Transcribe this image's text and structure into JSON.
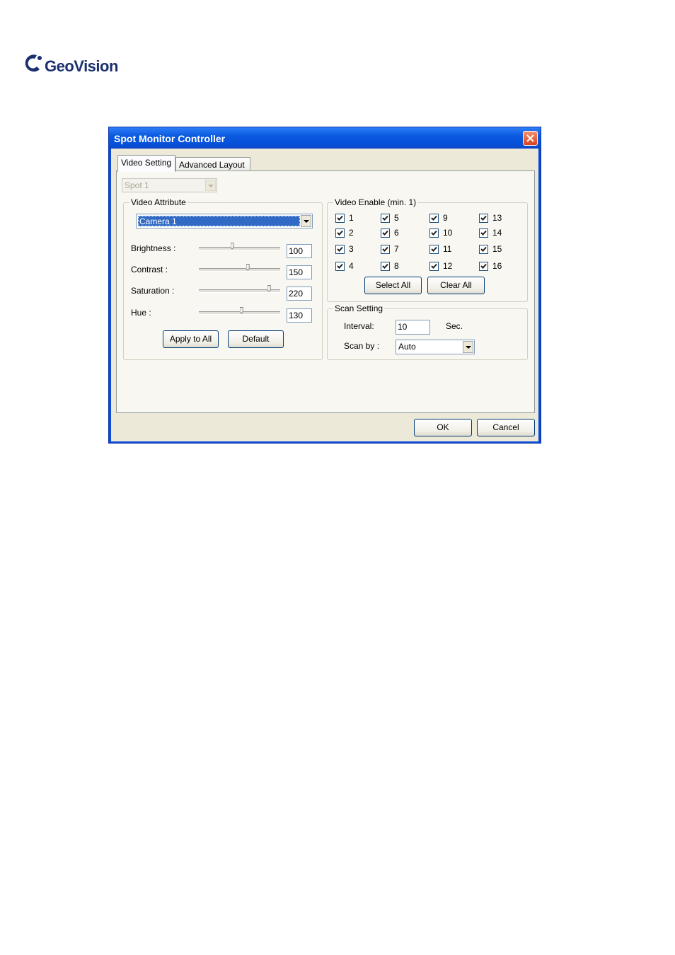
{
  "brand": {
    "name": "GeoVision"
  },
  "window": {
    "title": "Spot Monitor Controller"
  },
  "tabs": [
    {
      "label": "Video Setting",
      "active": true
    },
    {
      "label": "Advanced Layout",
      "active": false
    }
  ],
  "spot_select": {
    "value": "Spot 1"
  },
  "video_attribute": {
    "legend": "Video Attribute",
    "camera": "Camera 1",
    "sliders": [
      {
        "label": "Brightness :",
        "value": "100",
        "fraction": 0.4
      },
      {
        "label": "Contrast :",
        "value": "150",
        "fraction": 0.6
      },
      {
        "label": "Saturation :",
        "value": "220",
        "fraction": 0.87
      },
      {
        "label": "Hue :",
        "value": "130",
        "fraction": 0.52
      }
    ],
    "apply_label": "Apply to All",
    "default_label": "Default"
  },
  "video_enable": {
    "legend": "Video Enable (min. 1)",
    "cameras": [
      "1",
      "2",
      "3",
      "4",
      "5",
      "6",
      "7",
      "8",
      "9",
      "10",
      "11",
      "12",
      "13",
      "14",
      "15",
      "16"
    ],
    "select_all_label": "Select All",
    "clear_all_label": "Clear All"
  },
  "scan_setting": {
    "legend": "Scan Setting",
    "interval_label": "Interval:",
    "interval_value": "10",
    "interval_unit": "Sec.",
    "scan_by_label": "Scan by :",
    "scan_by_value": "Auto"
  },
  "footer": {
    "ok_label": "OK",
    "cancel_label": "Cancel"
  },
  "colors": {
    "titlebar": "#0a5ae0",
    "dialog_bg": "#ece9d8",
    "selection": "#316ac5",
    "close_button": "#d9411e"
  }
}
